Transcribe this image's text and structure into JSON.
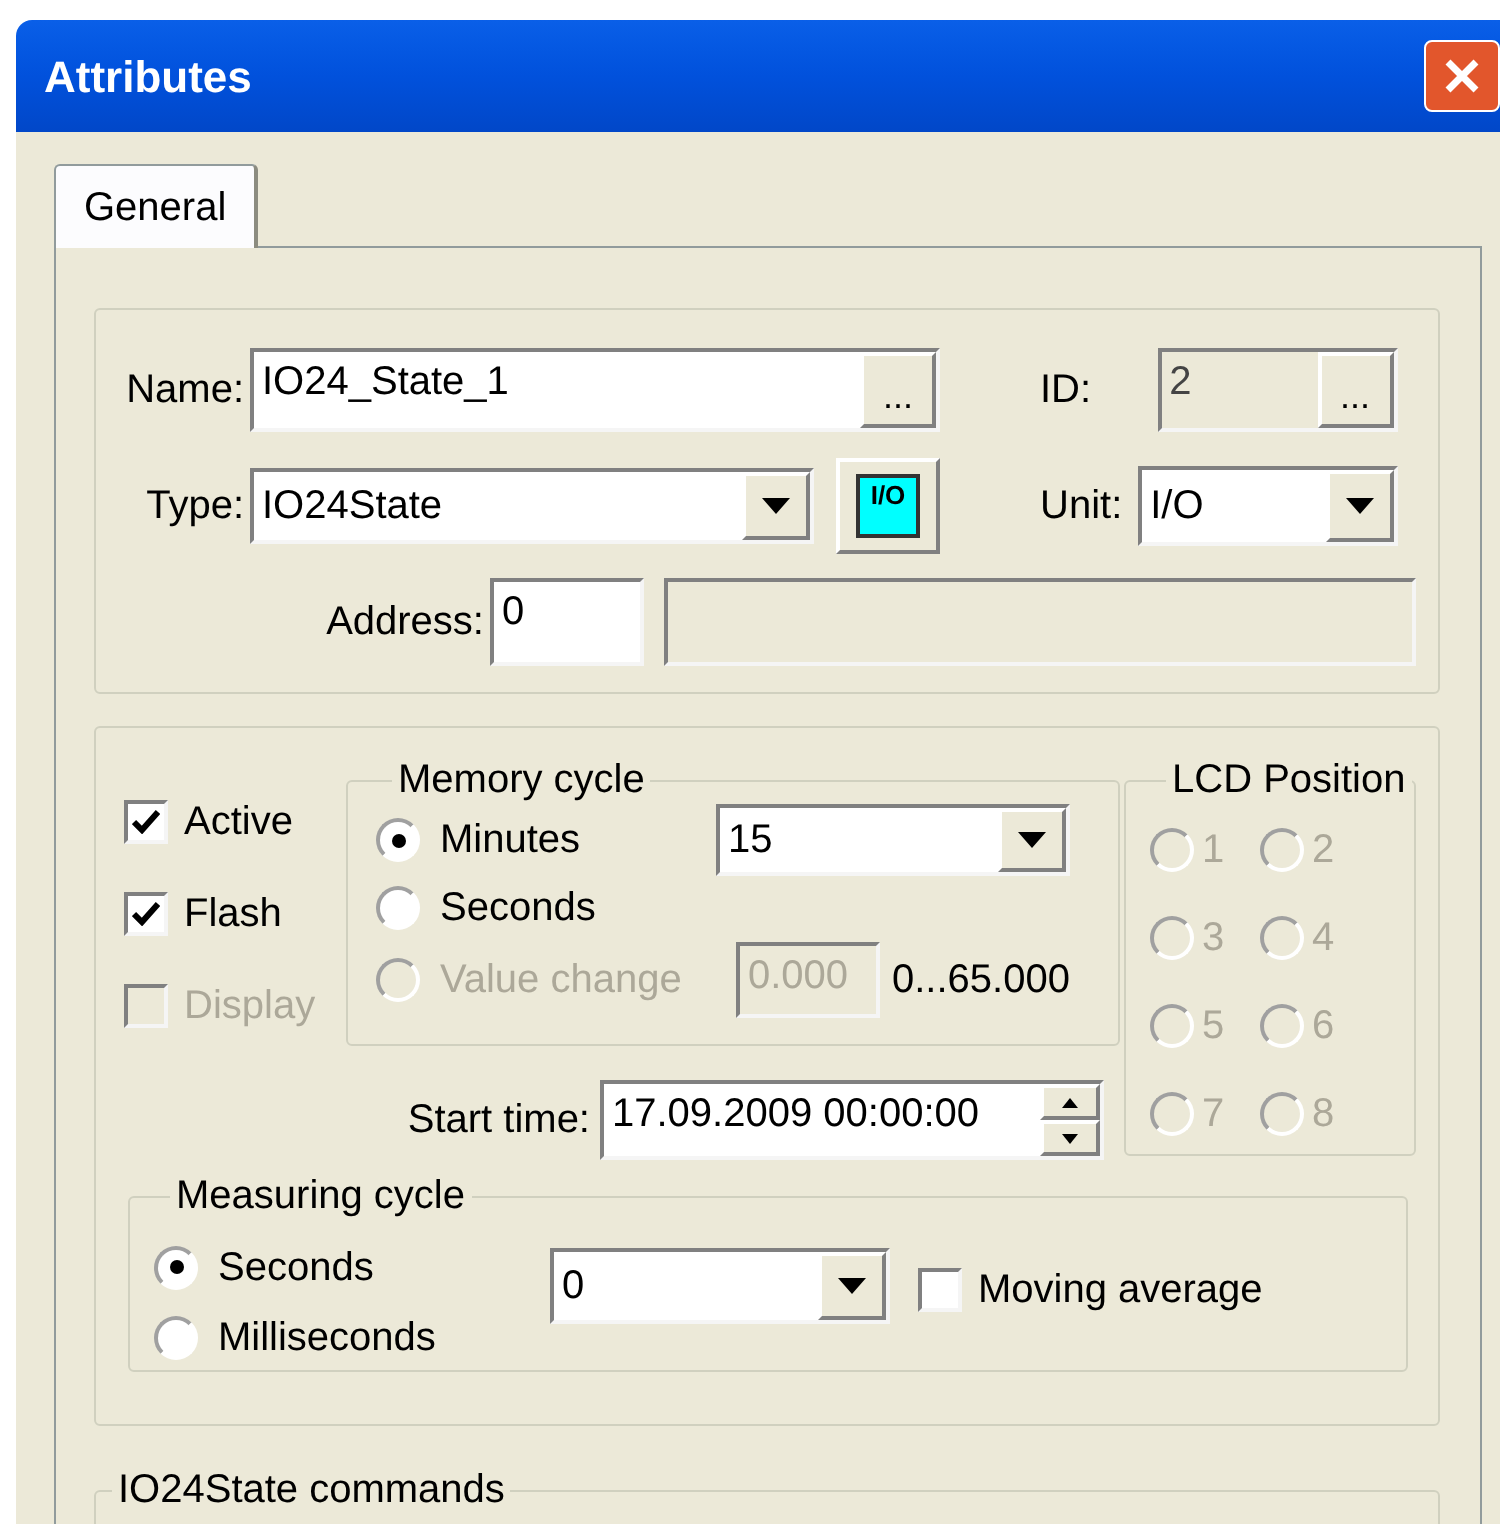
{
  "window": {
    "title": "Attributes"
  },
  "tabs": [
    {
      "label": "General",
      "selected": true
    }
  ],
  "name": {
    "label": "Name:",
    "value": "IO24_State_1",
    "button": "..."
  },
  "id": {
    "label": "ID:",
    "value": "2",
    "button": "..."
  },
  "type": {
    "label": "Type:",
    "value": "IO24State",
    "icon_text": "I/O"
  },
  "unit": {
    "label": "Unit:",
    "value": "I/O"
  },
  "address": {
    "label": "Address:",
    "value": "0"
  },
  "options": [
    {
      "label": "Active",
      "checked": true,
      "disabled": false
    },
    {
      "label": "Flash",
      "checked": true,
      "disabled": false
    },
    {
      "label": "Display",
      "checked": false,
      "disabled": true
    }
  ],
  "memory_cycle": {
    "title": "Memory cycle",
    "options": [
      {
        "label": "Minutes",
        "selected": true,
        "disabled": false
      },
      {
        "label": "Seconds",
        "selected": false,
        "disabled": false
      },
      {
        "label": "Value change",
        "selected": false,
        "disabled": true
      }
    ],
    "interval": "15",
    "value_change": "0.000",
    "range": "0...65.000"
  },
  "lcd_position": {
    "title": "LCD Position",
    "positions": [
      {
        "label": "1",
        "selected": false,
        "disabled": true
      },
      {
        "label": "2",
        "selected": false,
        "disabled": true
      },
      {
        "label": "3",
        "selected": false,
        "disabled": true
      },
      {
        "label": "4",
        "selected": false,
        "disabled": true
      },
      {
        "label": "5",
        "selected": false,
        "disabled": true
      },
      {
        "label": "6",
        "selected": false,
        "disabled": true
      },
      {
        "label": "7",
        "selected": false,
        "disabled": true
      },
      {
        "label": "8",
        "selected": false,
        "disabled": true
      }
    ]
  },
  "start_time": {
    "label": "Start time:",
    "value": "17.09.2009 00:00:00"
  },
  "measuring_cycle": {
    "title": "Measuring cycle",
    "options": [
      {
        "label": "Seconds",
        "selected": true,
        "disabled": false
      },
      {
        "label": "Milliseconds",
        "selected": false,
        "disabled": false
      }
    ],
    "interval": "0",
    "moving_average": {
      "label": "Moving average",
      "checked": false,
      "disabled": false
    }
  },
  "commands": {
    "title": "IO24State commands"
  }
}
